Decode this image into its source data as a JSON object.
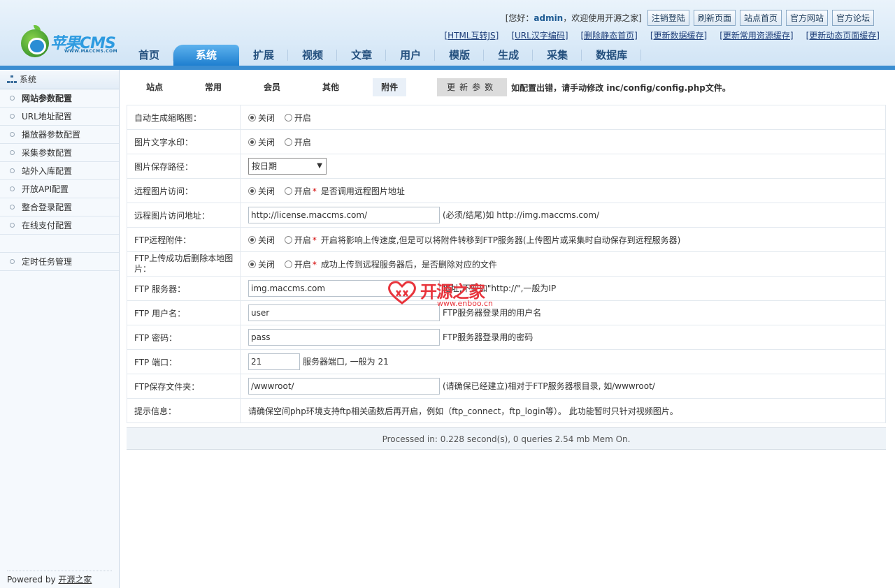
{
  "header": {
    "logo_text": "苹果CMS",
    "logo_sub": "WWW.MACCMS.COM",
    "greeting_prefix": "[您好：",
    "username": "admin",
    "greeting_suffix": "，欢迎使用开源之家]",
    "buttons": [
      "注销登陆",
      "刷新页面",
      "站点首页",
      "官方网站",
      "官方论坛"
    ],
    "links": [
      "[HTML互转JS]",
      "[URL汉字编码]",
      "[删除静态首页]",
      "[更新数据缓存]",
      "[更新常用资源缓存]",
      "[更新动态页面缓存]"
    ],
    "nav": [
      "首页",
      "系统",
      "扩展",
      "视频",
      "文章",
      "用户",
      "模版",
      "生成",
      "采集",
      "数据库"
    ],
    "nav_active": "系统"
  },
  "sidebar": {
    "title": "系统",
    "items": [
      "网站参数配置",
      "URL地址配置",
      "播放器参数配置",
      "采集参数配置",
      "站外入库配置",
      "开放API配置",
      "整合登录配置",
      "在线支付配置"
    ],
    "extra_item": "定时任务管理",
    "powered_prefix": "Powered by ",
    "powered_link": "开源之家"
  },
  "tabs": {
    "items": [
      "站点",
      "常用",
      "会员",
      "其他",
      "附件"
    ],
    "active": "附件",
    "update_button": "更新参数",
    "note": "如配置出错，请手动修改 inc/config/config.php文件。"
  },
  "form": {
    "off": "关闭",
    "on": "开启",
    "rows": {
      "thumb": {
        "label": "自动生成缩略图："
      },
      "watermark": {
        "label": "图片文字水印："
      },
      "path": {
        "label": "图片保存路径：",
        "value": "按日期"
      },
      "remote": {
        "label": "远程图片访问：",
        "hint": "是否调用远程图片地址"
      },
      "remote_url": {
        "label": "远程图片访问地址：",
        "value": "http://license.maccms.com/",
        "hint": "(必须/结尾)如 http://img.maccms.com/"
      },
      "ftp": {
        "label": "FTP远程附件：",
        "hint": "开启将影响上传速度,但是可以将附件转移到FTP服务器(上传图片或采集时自动保存到远程服务器)"
      },
      "ftp_del": {
        "label": "FTP上传成功后删除本地图片：",
        "hint": "成功上传到远程服务器后，是否删除对应的文件"
      },
      "ftp_server": {
        "label": "FTP 服务器：",
        "value": "img.maccms.com",
        "hint": "地址,不要加\"http://\",一般为IP"
      },
      "ftp_user": {
        "label": "FTP 用户名：",
        "value": "user",
        "hint": "FTP服务器登录用的用户名"
      },
      "ftp_pass": {
        "label": "FTP 密码：",
        "value": "pass",
        "hint": "FTP服务器登录用的密码"
      },
      "ftp_port": {
        "label": "FTP 端口：",
        "value": "21",
        "hint": "服务器端口, 一般为 21"
      },
      "ftp_dir": {
        "label": "FTP保存文件夹：",
        "value": "/wwwroot/",
        "hint": "(请确保已经建立)相对于FTP服务器根目录, 如/wwwroot/"
      },
      "info": {
        "label": "提示信息：",
        "text": "请确保空间php环境支持ftp相关函数后再开启，例如（ftp_connect，ftp_login等）。  此功能暂时只针对视频图片。"
      }
    }
  },
  "footer": "Processed in: 0.228 second(s), 0 queries 2.54 mb Mem On.",
  "watermark": {
    "title": "开源之家",
    "url": "www.enboo.cn"
  }
}
